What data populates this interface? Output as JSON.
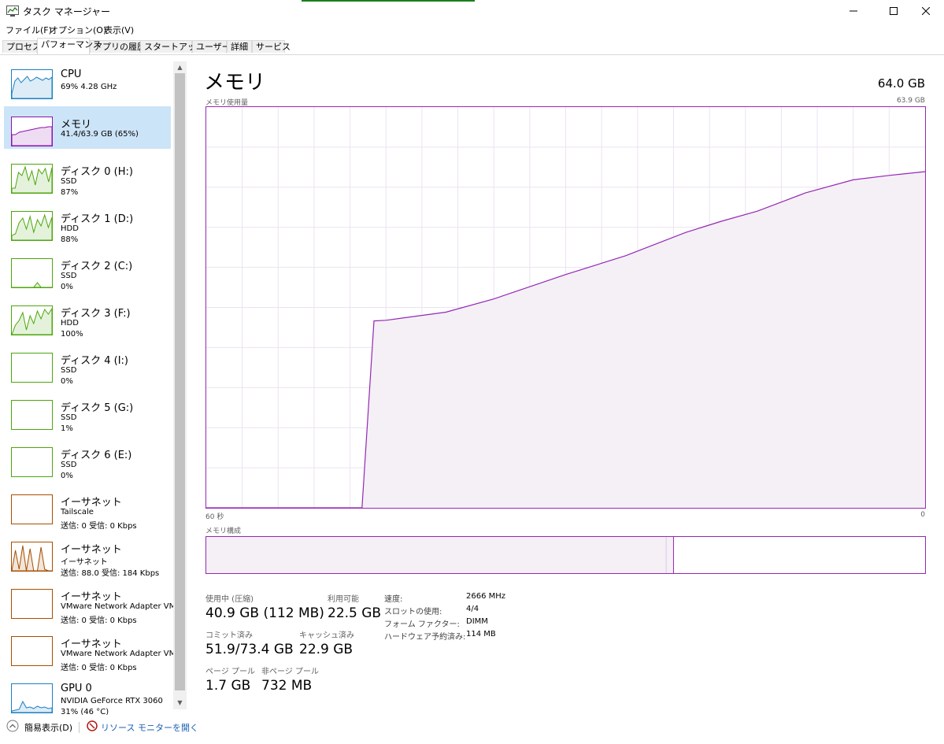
{
  "window": {
    "title": "タスク マネージャー"
  },
  "menu": [
    "ファイル(F)",
    "オプション(O)",
    "表示(V)"
  ],
  "tabs": [
    "プロセス",
    "パフォーマンス",
    "アプリの履歴",
    "スタートアップ",
    "ユーザー",
    "詳細",
    "サービス"
  ],
  "active_tab_index": 1,
  "sidebar": [
    {
      "title": "CPU",
      "line2": "69%  4.28 GHz",
      "line3": "",
      "color": "#1b7fc4",
      "icon": "cpu-graph-icon"
    },
    {
      "title": "メモリ",
      "line2": "41.4/63.9 GB (65%)",
      "line3": "",
      "color": "#8b12ae",
      "icon": "memory-graph-icon",
      "selected": true
    },
    {
      "title": "ディスク 0 (H:)",
      "line2": "SSD",
      "line3": "87%",
      "color": "#4da60c",
      "icon": "disk-graph-icon"
    },
    {
      "title": "ディスク 1 (D:)",
      "line2": "HDD",
      "line3": "88%",
      "color": "#4da60c",
      "icon": "disk-graph-icon"
    },
    {
      "title": "ディスク 2 (C:)",
      "line2": "SSD",
      "line3": "0%",
      "color": "#4da60c",
      "icon": "disk-graph-icon"
    },
    {
      "title": "ディスク 3 (F:)",
      "line2": "HDD",
      "line3": "100%",
      "color": "#4da60c",
      "icon": "disk-graph-icon"
    },
    {
      "title": "ディスク 4 (I:)",
      "line2": "SSD",
      "line3": "0%",
      "color": "#4da60c",
      "icon": "disk-graph-icon"
    },
    {
      "title": "ディスク 5 (G:)",
      "line2": "SSD",
      "line3": "1%",
      "color": "#4da60c",
      "icon": "disk-graph-icon"
    },
    {
      "title": "ディスク 6 (E:)",
      "line2": "SSD",
      "line3": "0%",
      "color": "#4da60c",
      "icon": "disk-graph-icon"
    },
    {
      "title": "イーサネット",
      "line2": "Tailscale",
      "line3": "送信: 0 受信: 0 Kbps",
      "color": "#a74f01",
      "icon": "ethernet-graph-icon"
    },
    {
      "title": "イーサネット",
      "line2": "イーサネット",
      "line3": "送信: 88.0 受信: 184 Kbps",
      "color": "#a74f01",
      "icon": "ethernet-graph-icon"
    },
    {
      "title": "イーサネット",
      "line2": "VMware Network Adapter VM",
      "line3": "送信: 0 受信: 0 Kbps",
      "color": "#a74f01",
      "icon": "ethernet-graph-icon"
    },
    {
      "title": "イーサネット",
      "line2": "VMware Network Adapter VM",
      "line3": "送信: 0 受信: 0 Kbps",
      "color": "#a74f01",
      "icon": "ethernet-graph-icon"
    },
    {
      "title": "GPU 0",
      "line2": "NVIDIA GeForce RTX 3060",
      "line3": "31% (46 °C)",
      "color": "#1b7fc4",
      "icon": "gpu-graph-icon"
    }
  ],
  "main": {
    "title": "メモリ",
    "total": "64.0 GB",
    "usage_label": "メモリ使用量",
    "usage_max": "63.9 GB",
    "x_left": "60 秒",
    "x_right": "0",
    "composition_label": "メモリ構成",
    "stats": {
      "in_use_label": "使用中 (圧縮)",
      "in_use_value": "40.9 GB (112 MB)",
      "available_label": "利用可能",
      "available_value": "22.5 GB",
      "committed_label": "コミット済み",
      "committed_value": "51.9/73.4 GB",
      "cached_label": "キャッシュ済み",
      "cached_value": "22.9 GB",
      "paged_label": "ページ プール",
      "paged_value": "1.7 GB",
      "nonpaged_label": "非ページ プール",
      "nonpaged_value": "732 MB"
    },
    "specs": [
      {
        "label": "速度:",
        "value": "2666 MHz"
      },
      {
        "label": "スロットの使用:",
        "value": "4/4"
      },
      {
        "label": "フォーム ファクター:",
        "value": "DIMM"
      },
      {
        "label": "ハードウェア予約済み:",
        "value": "114 MB"
      }
    ]
  },
  "chart_data": {
    "type": "area",
    "x_range": [
      60,
      0
    ],
    "ylim": [
      0,
      63.9
    ],
    "y_unit": "GB",
    "x": [
      60,
      47,
      46,
      45,
      40,
      36,
      30,
      25,
      20,
      17,
      14,
      10,
      6,
      3,
      0
    ],
    "values": [
      0,
      0,
      29.8,
      29.9,
      31.2,
      33.3,
      37.2,
      40.2,
      43.9,
      45.7,
      47.3,
      50.2,
      52.3,
      53.0,
      53.6
    ]
  },
  "composition": {
    "in_use_fraction": 0.64,
    "modified_fraction": 0.01
  },
  "footer": {
    "fewer_details": "簡易表示(D)",
    "resource_monitor": "リソース モニターを開く"
  }
}
